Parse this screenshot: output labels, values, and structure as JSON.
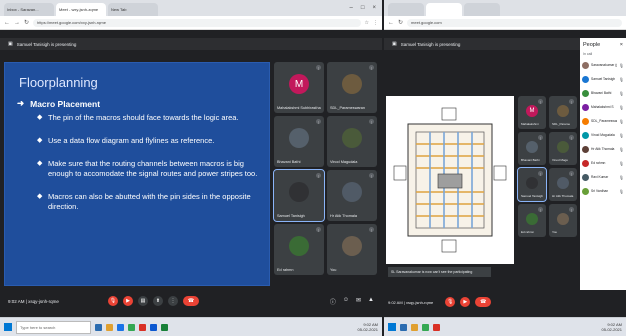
{
  "left": {
    "tabs": [
      "Inbox - Saravan...",
      "Meet - wxy-jsnh-zqme",
      "New Tab"
    ],
    "window_controls": [
      "–",
      "□",
      "×"
    ],
    "url": "https://meet.google.com/xxy-jsnh-rqme",
    "presenting_banner": "Samuel Tanisigh is presenting",
    "slide": {
      "title": "Floorplanning",
      "subheading": "Macro Placement",
      "bullets": [
        "The pin of the macros should face towards the logic area.",
        "Use a data flow diagram and flylines as reference.",
        "Make sure that the routing channels between macros is big enough to accomodate the signal routes and power stripes too.",
        "Macros can also be abutted with the pin sides in the opposite direction."
      ]
    },
    "participants": [
      {
        "name": "Mahalakshmi Subhirastha",
        "initial": "M",
        "color": "#c2185b"
      },
      {
        "name": "SDL_Parameswaran",
        "initial": "",
        "color": "#6d5b3f"
      },
      {
        "name": "Bhavani Bathi",
        "initial": "",
        "color": "#55606b"
      },
      {
        "name": "Vinod Magudala",
        "initial": "",
        "color": "#4a5a3a"
      },
      {
        "name": "Samuel Tanisigh",
        "initial": "",
        "color": "#303134"
      },
      {
        "name": "Hr Atik Thomala",
        "initial": "",
        "color": "#505a66"
      },
      {
        "name": "Ed rahmn",
        "initial": "",
        "color": "#3a6b35"
      },
      {
        "name": "You",
        "initial": "",
        "color": "#6b5e4f"
      }
    ],
    "meeting_info": "9:02 AM | xsqy-jsnh-rqme",
    "taskbar_search": "Type here to search",
    "clock": [
      "9:02 AM",
      "05-02-2021"
    ]
  },
  "right": {
    "url": "meet.google.com",
    "presenting_banner": "Samuel Tanisigh is presenting",
    "caption": "SL Saravanakumar is now can't see the participating",
    "participants": [
      {
        "name": "Mahalakshmi",
        "initial": "M",
        "color": "#c2185b"
      },
      {
        "name": "SDL_Parame",
        "initial": "",
        "color": "#6d5b3f"
      },
      {
        "name": "Bhavani Bathi",
        "initial": "",
        "color": "#55606b"
      },
      {
        "name": "Vinod Magu",
        "initial": "",
        "color": "#4a5a3a"
      },
      {
        "name": "Samuel Tanisigh",
        "initial": "",
        "color": "#303134"
      },
      {
        "name": "Hr Atik Thomala",
        "initial": "",
        "color": "#505a66"
      },
      {
        "name": "Ed rahmn",
        "initial": "",
        "color": "#3a6b35"
      },
      {
        "name": "You",
        "initial": "",
        "color": "#6b5e4f"
      }
    ],
    "people_panel": {
      "title": "People",
      "section": "In call",
      "people": [
        {
          "name": "Saravanakumar (you)",
          "color": "#8d6e63"
        },
        {
          "name": "Samuel Tanisigh",
          "color": "#1976d2"
        },
        {
          "name": "Bhavani Bathi",
          "color": "#388e3c"
        },
        {
          "name": "Mahalakshmi S",
          "color": "#7b1fa2"
        },
        {
          "name": "SDL_Parameswaran",
          "color": "#f57c00"
        },
        {
          "name": "Vinod Magudala",
          "color": "#0097a7"
        },
        {
          "name": "Hr Atik Thomala",
          "color": "#5d4037"
        },
        {
          "name": "Ed rahmn",
          "color": "#c62828"
        },
        {
          "name": "Ravi Kumar",
          "color": "#455a64"
        },
        {
          "name": "Sri Vardhan",
          "color": "#689f38"
        }
      ]
    },
    "meeting_info": "9:02 AM | xsqy-jsnh-rqme",
    "clock": [
      "9:02 AM",
      "05-02-2021"
    ]
  }
}
